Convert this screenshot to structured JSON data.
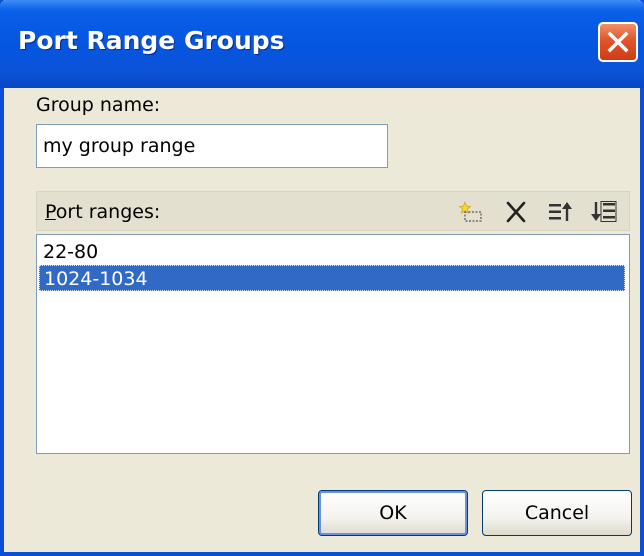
{
  "window": {
    "title": "Port Range Groups"
  },
  "group_name": {
    "label": "Group name:",
    "value": "my group range"
  },
  "port_ranges": {
    "label": "Port ranges:",
    "toolbar": [
      "new-item-icon",
      "delete-icon",
      "move-up-icon",
      "move-down-icon"
    ],
    "items": [
      {
        "text": "22-80",
        "selected": false
      },
      {
        "text": "1024-1034",
        "selected": true
      }
    ]
  },
  "buttons": {
    "ok": "OK",
    "cancel": "Cancel"
  },
  "colors": {
    "title_bar": "#0555e0",
    "selection": "#316ac5",
    "dialog_bg": "#ece9d8",
    "close_button": "#e0552a"
  }
}
